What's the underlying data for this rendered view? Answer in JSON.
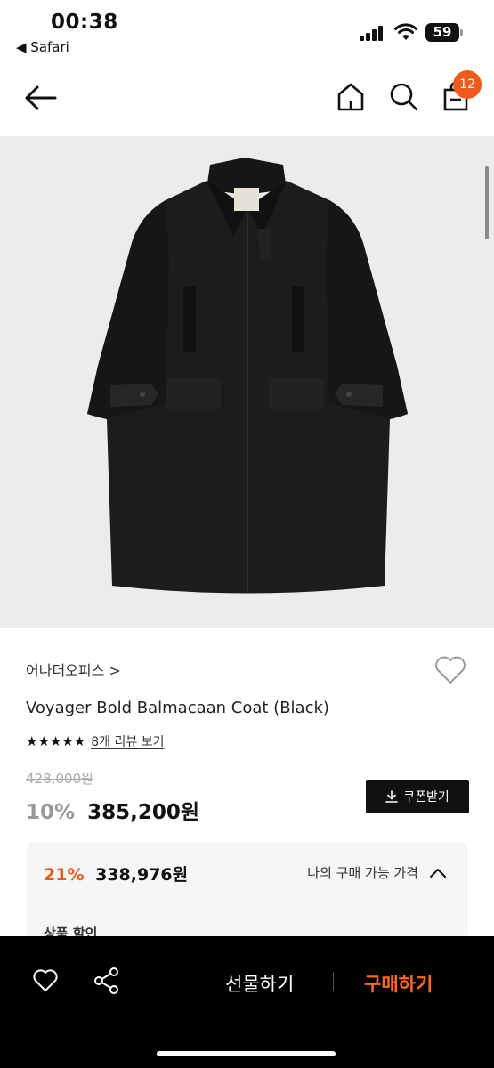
{
  "status_bar": {
    "time": "00:38",
    "back_app": "◀ Safari",
    "battery": "59"
  },
  "nav": {
    "icons": [
      "back-arrow-icon",
      "home-icon",
      "search-icon",
      "cart-icon"
    ],
    "cart_count": "12"
  },
  "product": {
    "brand": "어나더오피스 >",
    "title": "Voyager Bold Balmacaan Coat (Black)",
    "stars": "★★★★★",
    "rating": 5,
    "review_link": "8개 리뷰 보기",
    "original_price": "428,000원",
    "discount": "10%",
    "price": "385,200원",
    "coupon_label": "쿠폰받기"
  },
  "benefit": {
    "percent": "21%",
    "price": "338,976원",
    "label": "나의 구매 가능 가격",
    "sub": "상품 할인"
  },
  "bottom_bar": {
    "gift": "선물하기",
    "buy": "구매하기"
  },
  "colors": {
    "accent": "#f05a1a",
    "buy": "#ff6a1f"
  }
}
